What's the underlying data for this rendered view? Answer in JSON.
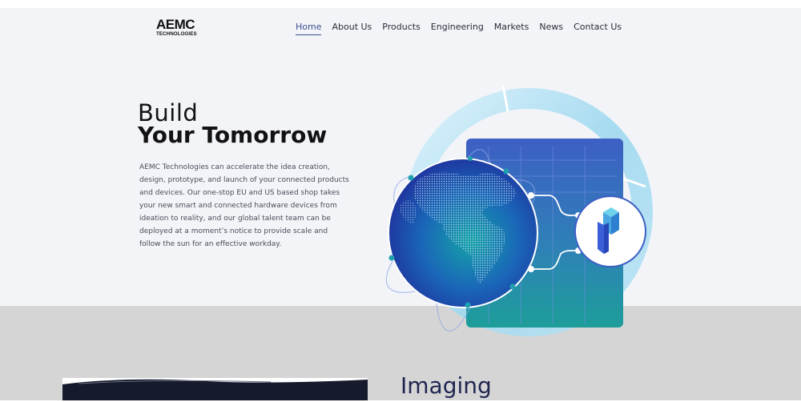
{
  "brand": {
    "logo_main": "AEMC",
    "logo_sub": "TECHNOLOGIES"
  },
  "nav": {
    "items": [
      {
        "label": "Home",
        "active": true
      },
      {
        "label": "About Us"
      },
      {
        "label": "Products"
      },
      {
        "label": "Engineering"
      },
      {
        "label": "Markets"
      },
      {
        "label": "News"
      },
      {
        "label": "Contact Us"
      }
    ]
  },
  "hero": {
    "heading_line1": "Build",
    "heading_line2": "Your Tomorrow",
    "description": "AEMC Technologies can accelerate the idea creation, design, prototype, and launch of your connected products and devices. Our one-stop EU and US based shop takes your new smart and connected hardware devices from ideation to reality, and our global talent team can be deployed at a moment’s notice to provide scale and follow the sun for an effective workday."
  },
  "next_section": {
    "title": "Imaging"
  },
  "colors": {
    "hero_bg": "#f2f4f8",
    "lower_bg": "#d5d5d5",
    "nav_active": "#3b4f8f",
    "globe_dark": "#1f3fb0",
    "globe_teal": "#16a3a8",
    "ring": "#9ed8ef",
    "panel_blue": "#3d5fc4",
    "panel_teal": "#1d9e9a"
  },
  "icons": [
    "globe-illustration",
    "server-panel",
    "isometric-cube-icon"
  ]
}
